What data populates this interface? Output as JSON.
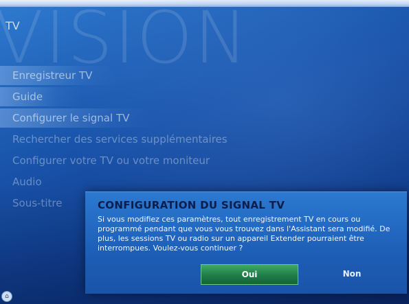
{
  "page": {
    "section_title": "TV",
    "watermark": "VISION"
  },
  "menu": {
    "items": [
      {
        "label": "Enregistreur TV",
        "active": true
      },
      {
        "label": "Guide",
        "active": true
      },
      {
        "label": "Configurer le signal TV",
        "active": true
      },
      {
        "label": "Rechercher des services supplémentaires",
        "active": false
      },
      {
        "label": "Configurer votre TV ou votre moniteur",
        "active": false
      },
      {
        "label": "Audio",
        "active": false
      },
      {
        "label": "Sous-titre",
        "active": false
      }
    ]
  },
  "dialog": {
    "title": "CONFIGURATION DU SIGNAL TV",
    "message": "Si vous modifiez ces paramètres, tout enregistrement TV en cours ou programmé pendant que vous vous trouvez dans l'Assistant sera modifié. De plus, les sessions TV ou radio sur un appareil Extender pourraient être interrompues. Voulez-vous continuer ?",
    "yes_label": "Oui",
    "no_label": "Non"
  },
  "icons": {
    "corner": "home-icon"
  },
  "colors": {
    "background": "#1a56ad",
    "dialog": "#2c79d0",
    "yes_button": "#1f7d48",
    "title_text": "#0b1d4a"
  }
}
